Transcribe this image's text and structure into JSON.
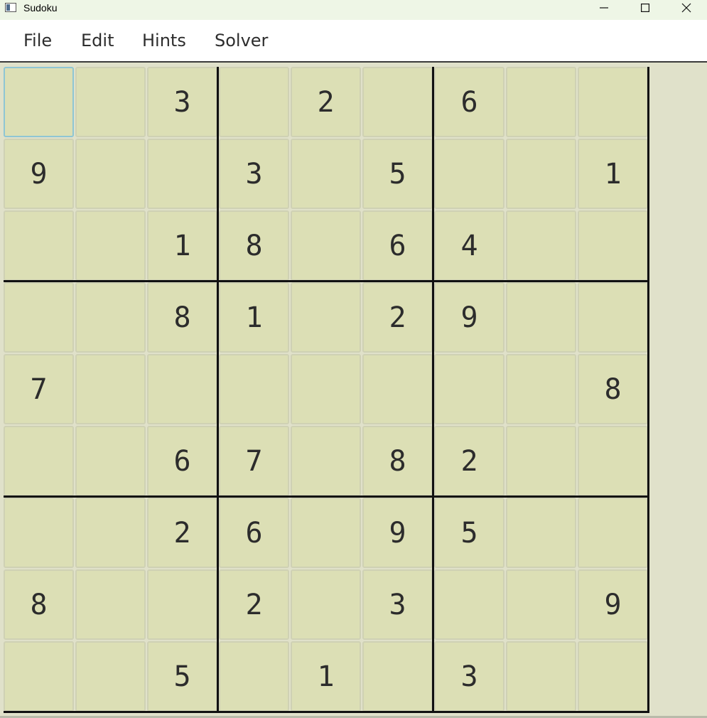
{
  "window": {
    "title": "Sudoku",
    "icon": "window-app-icon"
  },
  "menu": {
    "items": [
      "File",
      "Edit",
      "Hints",
      "Solver"
    ]
  },
  "board": {
    "selected": [
      0,
      0
    ],
    "colors": {
      "cell_background": "#dcdfb5",
      "selection_border": "#8fc6d4",
      "box_line": "#111111",
      "app_background": "#e0e1ca"
    },
    "grid": [
      [
        "",
        "",
        "3",
        "",
        "2",
        "",
        "6",
        "",
        ""
      ],
      [
        "9",
        "",
        "",
        "3",
        "",
        "5",
        "",
        "",
        "1"
      ],
      [
        "",
        "",
        "1",
        "8",
        "",
        "6",
        "4",
        "",
        ""
      ],
      [
        "",
        "",
        "8",
        "1",
        "",
        "2",
        "9",
        "",
        ""
      ],
      [
        "7",
        "",
        "",
        "",
        "",
        "",
        "",
        "",
        "8"
      ],
      [
        "",
        "",
        "6",
        "7",
        "",
        "8",
        "2",
        "",
        ""
      ],
      [
        "",
        "",
        "2",
        "6",
        "",
        "9",
        "5",
        "",
        ""
      ],
      [
        "8",
        "",
        "",
        "2",
        "",
        "3",
        "",
        "",
        "9"
      ],
      [
        "",
        "",
        "5",
        "",
        "1",
        "",
        "3",
        "",
        ""
      ]
    ]
  }
}
